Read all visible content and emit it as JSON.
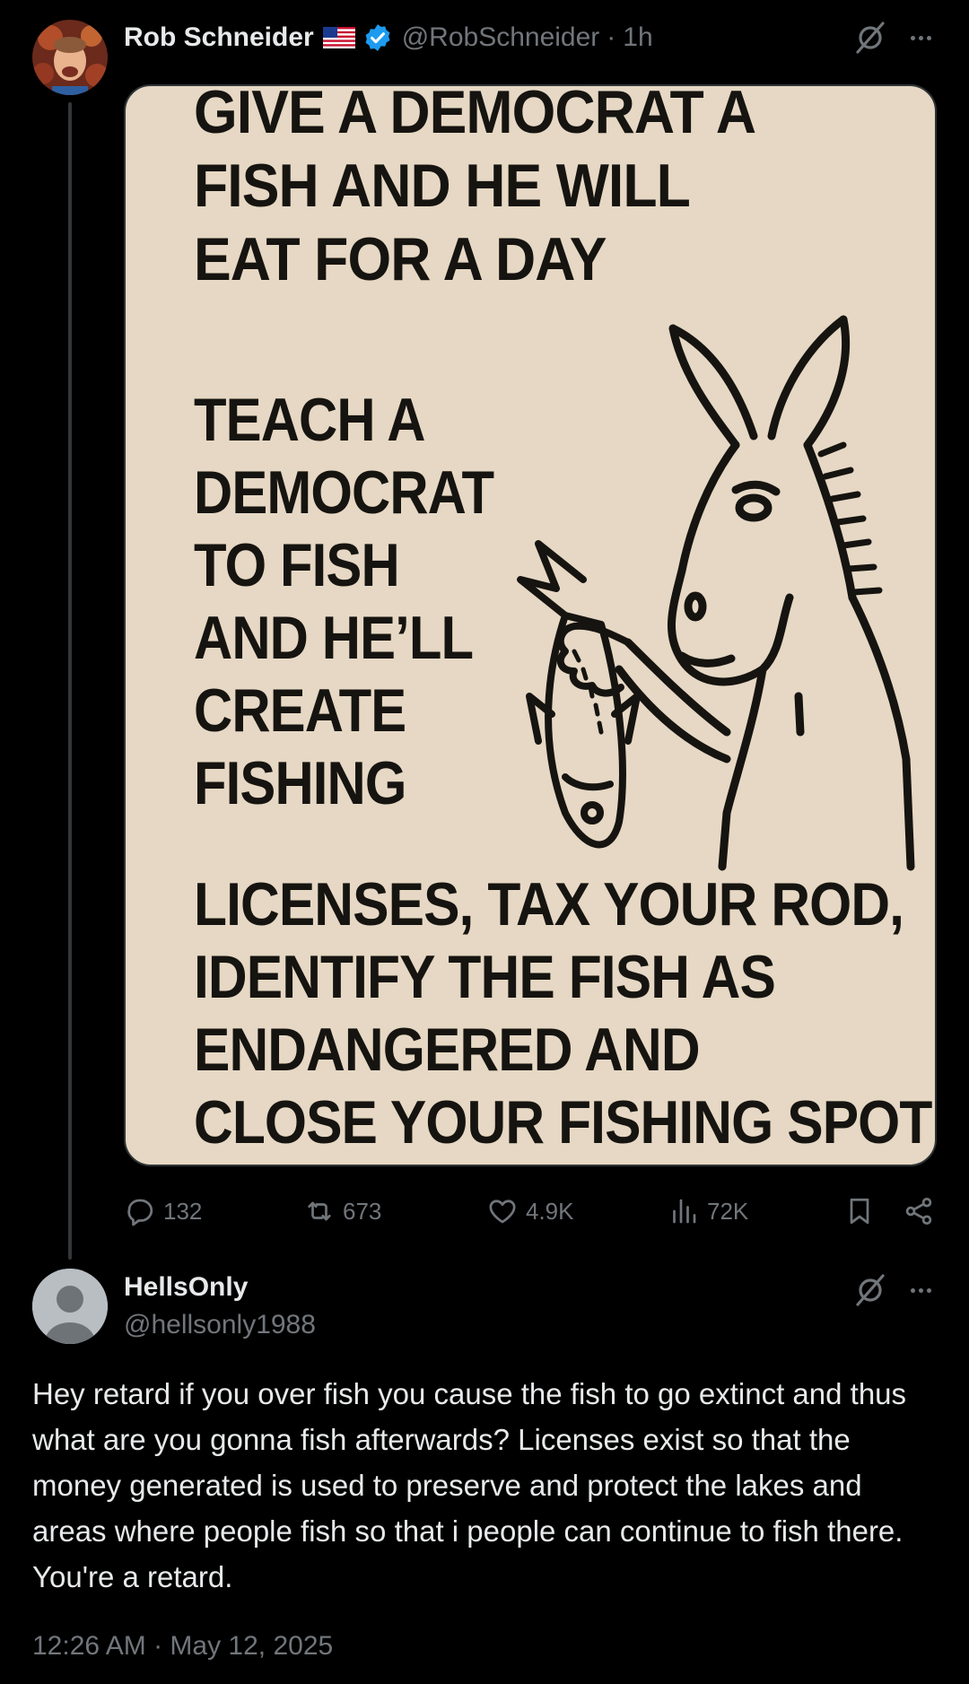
{
  "colors": {
    "background": "#000000",
    "text_primary": "#e7e9ea",
    "text_secondary": "#71767b",
    "verified": "#1d9bf0",
    "meme_paper": "#e6d8c4",
    "meme_ink": "#161410"
  },
  "post": {
    "author_name": "Rob Schneider",
    "author_handle": "@RobSchneider",
    "separator": "·",
    "time_ago": "1h",
    "badges": [
      "us-flag-icon",
      "verified-badge-icon"
    ],
    "media": {
      "top_lines": [
        "GIVE A DEMOCRAT A",
        "FISH AND HE WILL",
        "EAT FOR A DAY"
      ],
      "middle_lines": [
        "TEACH A",
        "DEMOCRAT",
        "TO FISH",
        "AND HE’LL",
        "CREATE",
        "FISHING"
      ],
      "bottom_lines": [
        "LICENSES, TAX YOUR ROD,",
        "IDENTIFY THE FISH AS",
        "ENDANGERED AND",
        "CLOSE YOUR FISHING SPOT"
      ]
    },
    "stats": {
      "replies": "132",
      "reposts": "673",
      "likes": "4.9K",
      "views": "72K"
    },
    "icons": {
      "reply": "reply-icon",
      "repost": "repost-icon",
      "like": "heart-icon",
      "views": "views-icon",
      "bookmark": "bookmark-icon",
      "share": "share-icon",
      "grok": "grok-icon",
      "more": "more-icon"
    }
  },
  "reply": {
    "author_name": "HellsOnly",
    "author_handle": "@hellsonly1988",
    "text": "Hey retard if you over fish you cause the fish to go extinct and thus what are you gonna fish afterwards? Licenses exist so that the money generated is used to preserve and protect the lakes and areas where people fish so that i people can continue to fish there. You're a retard.",
    "timestamp": "12:26 AM · May 12, 2025"
  }
}
